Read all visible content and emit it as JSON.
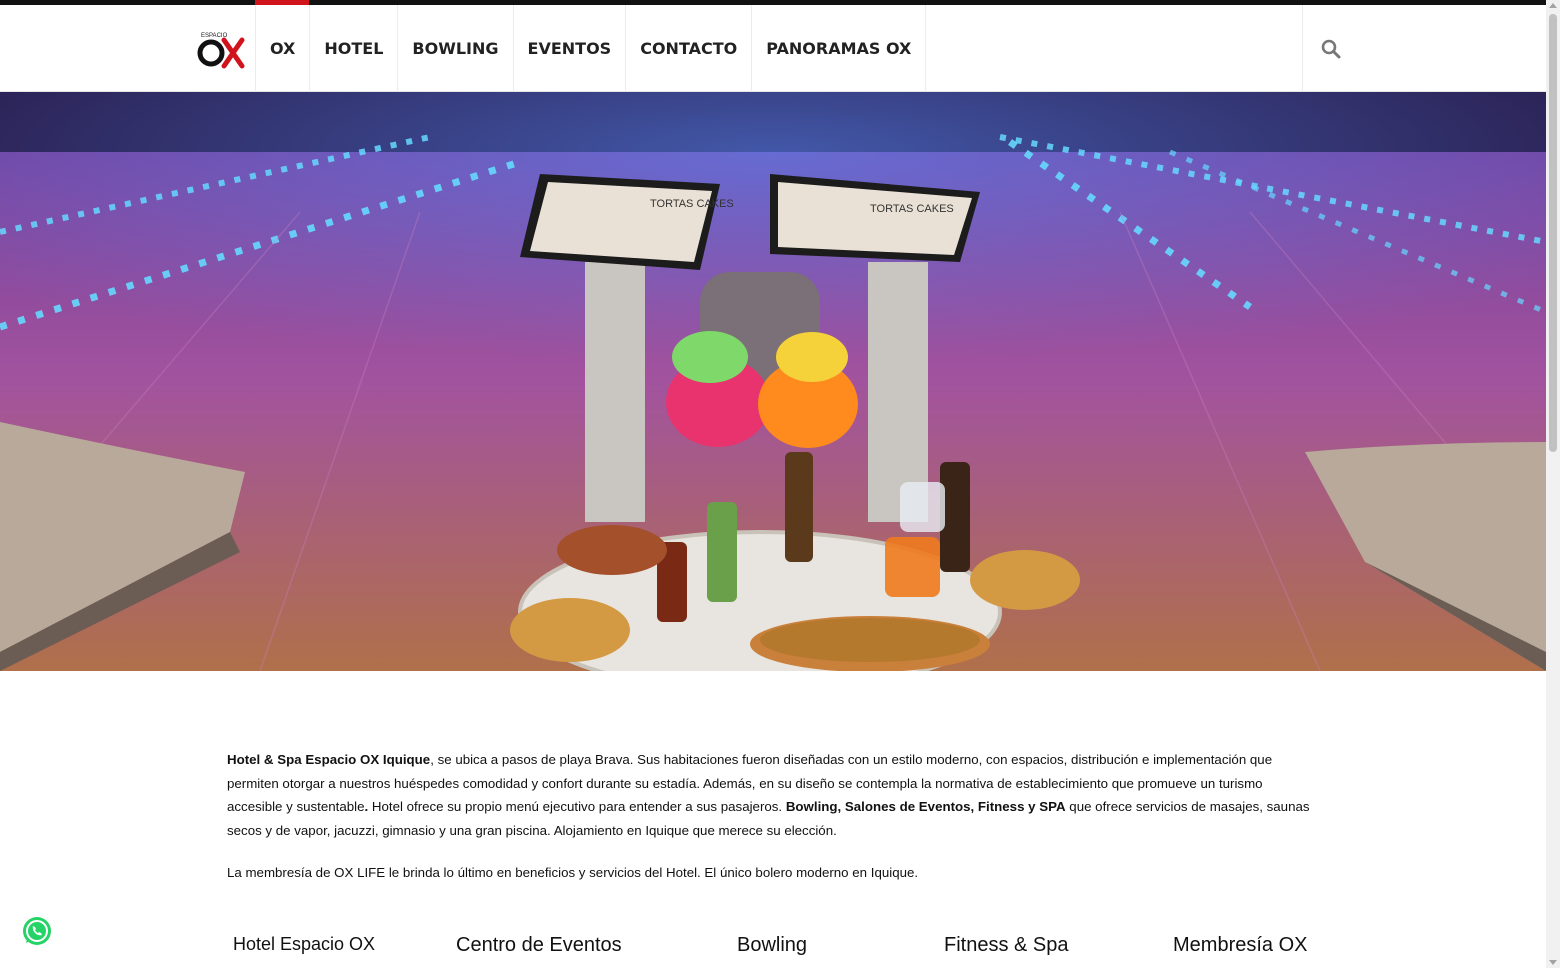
{
  "brand": {
    "logo_small": "ESPACIO",
    "logo_big": "OX",
    "accent": "#d1141b"
  },
  "nav": {
    "items": [
      {
        "label": "OX",
        "active": true
      },
      {
        "label": "HOTEL"
      },
      {
        "label": "BOWLING"
      },
      {
        "label": "EVENTOS"
      },
      {
        "label": "CONTACTO"
      },
      {
        "label": "PANORAMAS OX"
      }
    ],
    "search_icon": "search-icon"
  },
  "hero": {
    "slide_count": 5,
    "active_slide": 2,
    "screen_text": "TORTAS CAKES"
  },
  "intro": {
    "p1": {
      "a": "Hotel & Spa Espacio OX Iquique",
      "b": ", se ubica a pasos de playa Brava. Sus habitaciones fueron diseñadas con un estilo moderno, con espacios, distribución e implementación que permiten otorgar a nuestros huéspedes comodidad y confort durante su estadía. Además, en su diseño se contempla la normativa de establecimiento que promueve un turismo accesible y sustentable",
      "c": ".",
      "d": " Hotel ofrece su propio menú ejecutivo para entender a sus pasajeros. ",
      "e": "Bowling, Salones de Eventos, Fitness y  SPA",
      "f": " que ofrece servicios de masajes, saunas secos y de vapor, jacuzzi, gimnasio y una gran piscina.  Alojamiento en Iquique que merece su elección."
    },
    "p2": "La membresía de OX LIFE le brinda lo último en beneficios y servicios del Hotel. El único bolero moderno en Iquique."
  },
  "features": [
    "Hotel Espacio OX",
    "Centro de Eventos",
    "Bowling",
    "Fitness & Spa",
    "Membresía OX"
  ],
  "whatsapp_icon": "whatsapp-icon"
}
